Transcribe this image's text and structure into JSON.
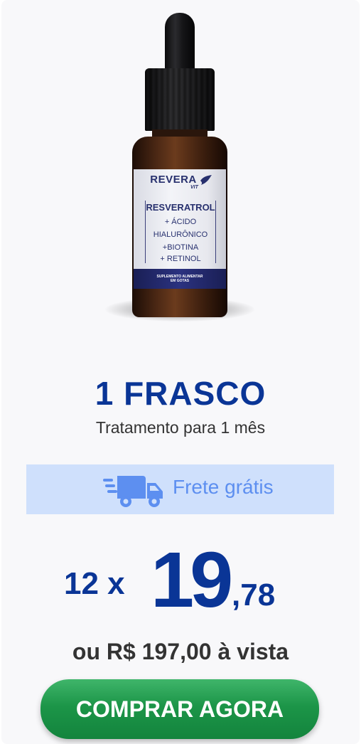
{
  "product": {
    "brand": "REVERA",
    "brand_sub": "VIT",
    "label_lines": [
      "RESVERATROL",
      "+ ÁCIDO",
      "HIALURÔNICO",
      "+BIOTINA",
      "+ RETINOL"
    ],
    "label_footer": [
      "SUPLEMENTO ALIMENTAR",
      "EM GOTAS"
    ]
  },
  "offer": {
    "title": "1 FRASCO",
    "subtitle": "Tratamento para 1 mês"
  },
  "shipping": {
    "label": "Frete grátis",
    "icon": "delivery-truck-icon",
    "color": "#5d8ff0",
    "background": "#cfe0fc"
  },
  "price": {
    "installments": "12 x",
    "integer": "19",
    "decimal": ",78",
    "cash": "ou R$ 197,00 à vista"
  },
  "cta": {
    "label": "COMPRAR AGORA",
    "color": "#1c9548"
  },
  "colors": {
    "primary": "#0a3596",
    "text": "#333333"
  }
}
